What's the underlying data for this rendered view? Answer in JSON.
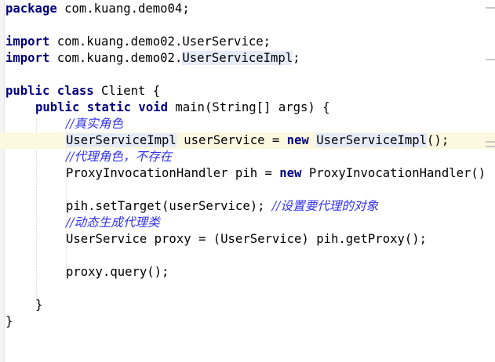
{
  "code": {
    "package_kw": "package",
    "package_name": " com.kuang.demo04;",
    "import_kw": "import",
    "import1_path": " com.kuang.demo02.UserService;",
    "import2_prefix": " com.kuang.demo02.",
    "import2_class": "UserServiceImpl",
    "import2_suffix": ";",
    "class_kw": "public class",
    "class_name": " Client {",
    "method_kw": "public static void",
    "method_sig": " main(String[] args) {",
    "comment_real_role": "//真实角色",
    "line_real_role_type": "UserServiceImpl",
    "line_real_role_mid": " userService = ",
    "new_kw": "new",
    "line_real_role_ctor": "UserServiceImpl",
    "line_real_role_end": "();",
    "comment_proxy_role": "//代理角色，不存在",
    "line_pih_decl": "ProxyInvocationHandler pih = ",
    "line_pih_ctor": " ProxyInvocationHandler()",
    "line_set_target": "pih.setTarget(userService); ",
    "comment_set_target": "//设置要代理的对象",
    "comment_dynamic": "//动态生成代理类",
    "line_get_proxy": "UserService proxy = (UserService) pih.getProxy();",
    "line_query": "proxy.query();",
    "close_method": "}",
    "close_class": "}"
  },
  "colors": {
    "keyword": "#000080",
    "comment": "#3333ee",
    "current_line": "#fcf8e0",
    "usage_highlight": "#e6ebf8"
  }
}
